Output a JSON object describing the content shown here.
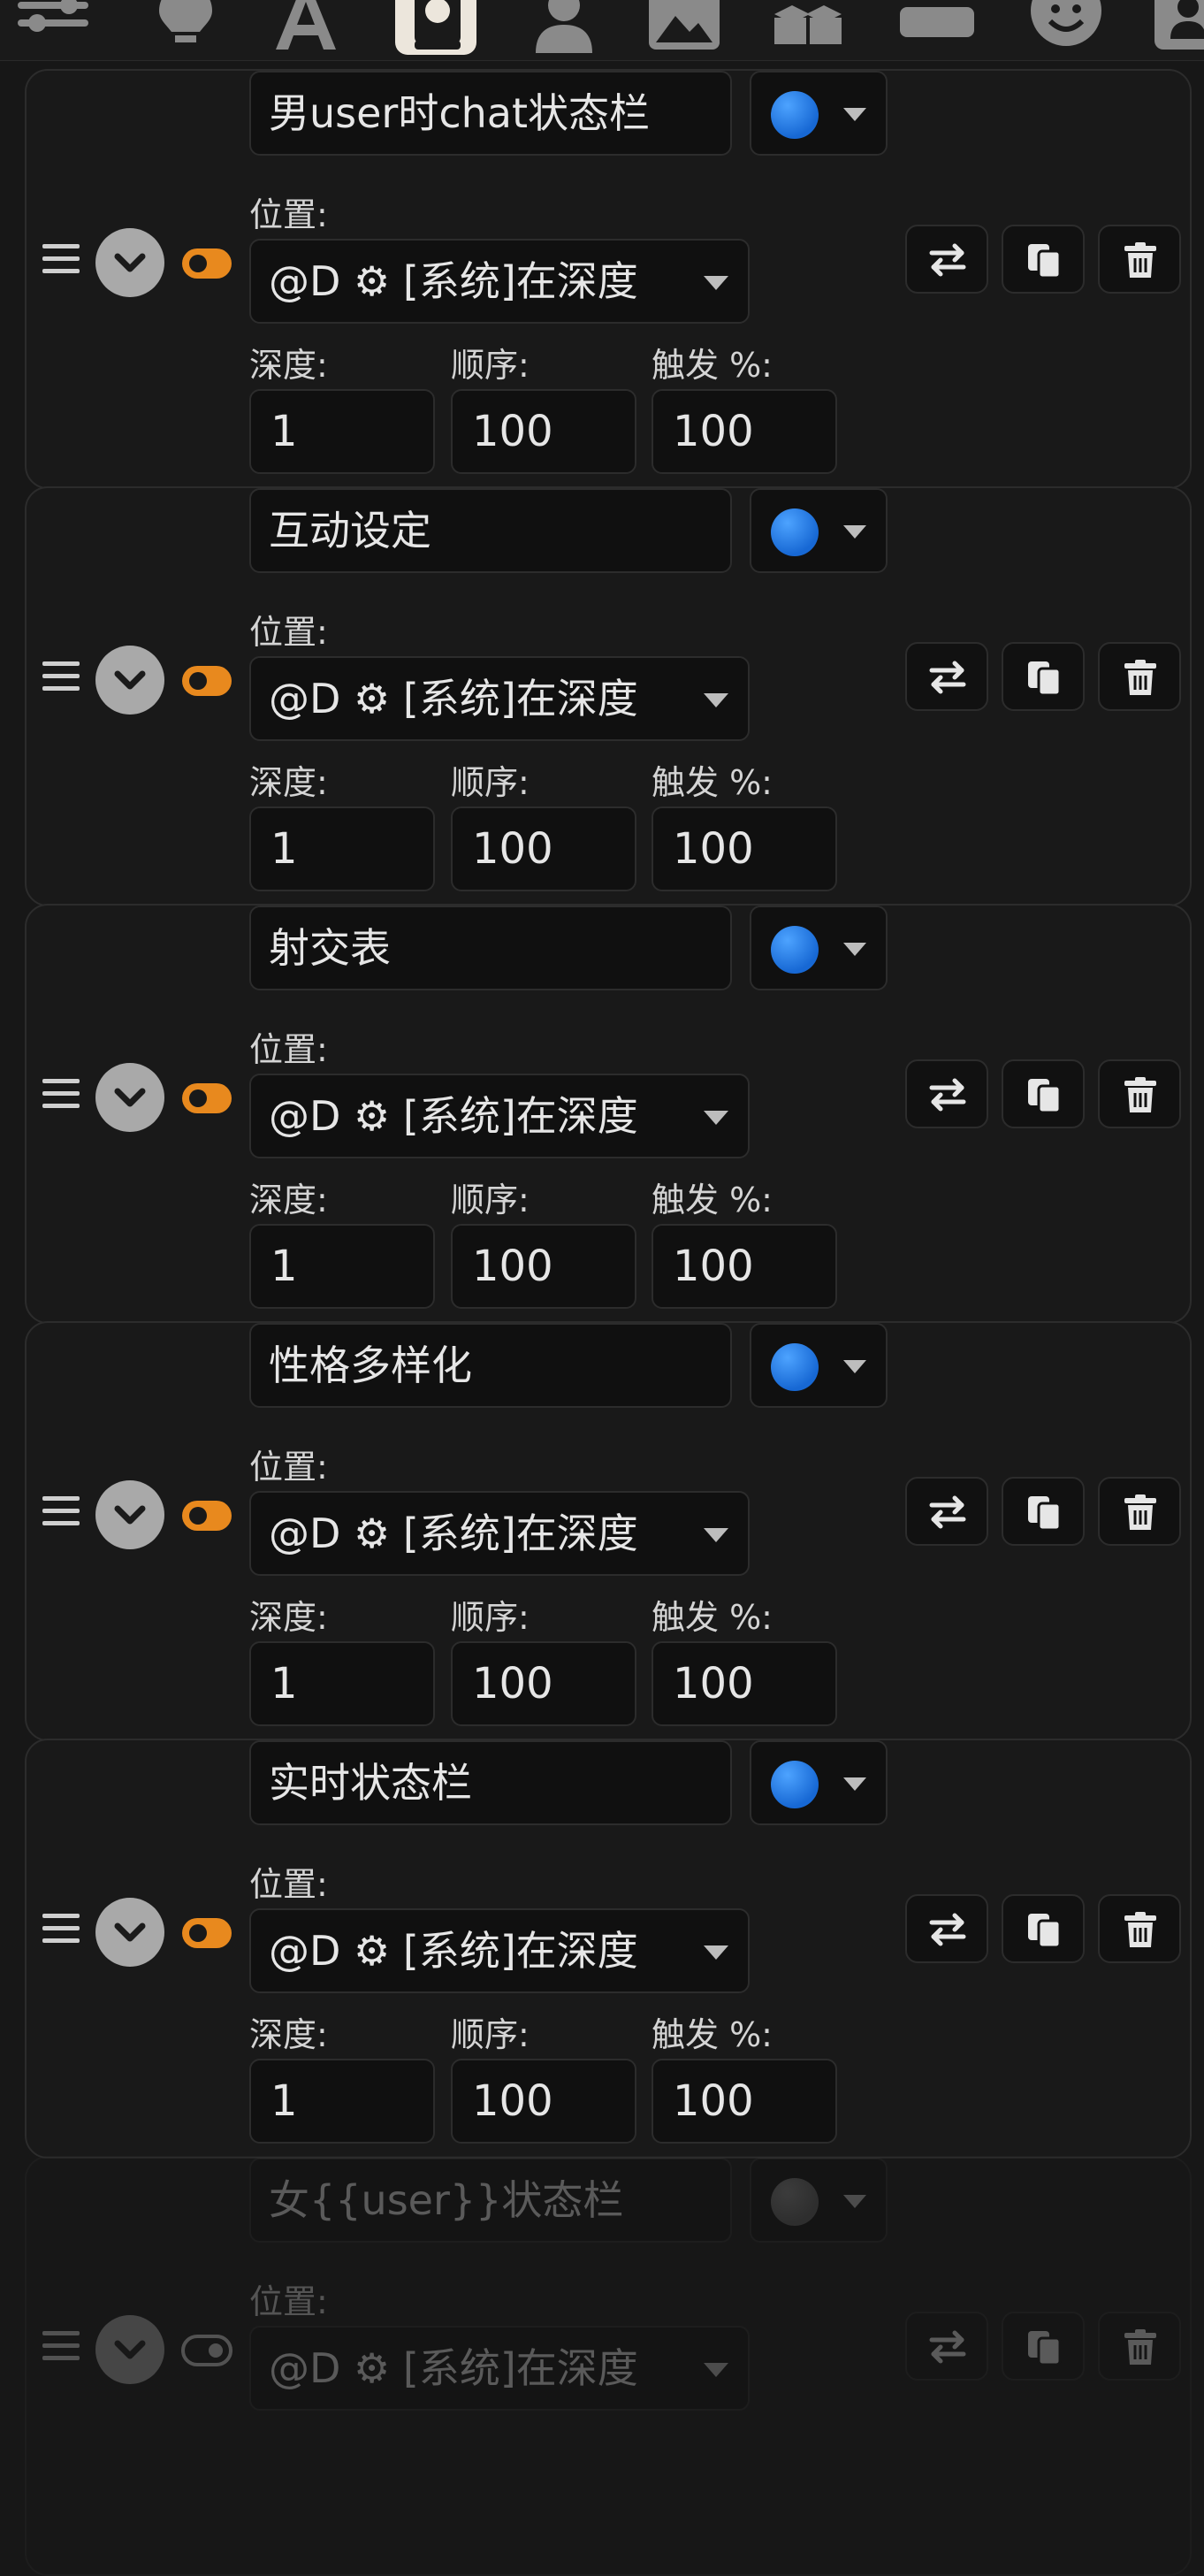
{
  "toolbar": {
    "icons": [
      "sliders-icon",
      "lightbulb-icon",
      "font-icon",
      "book-icon",
      "user-icon",
      "image-icon",
      "cubes-icon",
      "id-card-icon",
      "smile-icon",
      "user-card-icon"
    ],
    "active": "book-icon"
  },
  "labels": {
    "position": "位置:",
    "depth": "深度:",
    "order": "顺序:",
    "trigger": "触发 %:"
  },
  "entries": [
    {
      "title": "男user时chat状态栏",
      "color": "blue",
      "enabled": true,
      "position": "@D ⚙ [系统]在深度",
      "depth": "1",
      "order": "100",
      "trigger": "100"
    },
    {
      "title": "互动设定",
      "color": "blue",
      "enabled": true,
      "position": "@D ⚙ [系统]在深度",
      "depth": "1",
      "order": "100",
      "trigger": "100"
    },
    {
      "title": "射交表",
      "color": "blue",
      "enabled": true,
      "position": "@D ⚙ [系统]在深度",
      "depth": "1",
      "order": "100",
      "trigger": "100"
    },
    {
      "title": "性格多样化",
      "color": "blue",
      "enabled": true,
      "position": "@D ⚙ [系统]在深度",
      "depth": "1",
      "order": "100",
      "trigger": "100"
    },
    {
      "title": "实时状态栏",
      "color": "blue",
      "enabled": true,
      "position": "@D ⚙ [系统]在深度",
      "depth": "1",
      "order": "100",
      "trigger": "100"
    },
    {
      "title": "女{{user}}状态栏",
      "color": "grey",
      "enabled": false,
      "position": "@D ⚙ [系统]在深度"
    }
  ],
  "colors": {
    "accent": "#e8891e",
    "status_dot": "#1f78e6",
    "background": "#171717"
  }
}
